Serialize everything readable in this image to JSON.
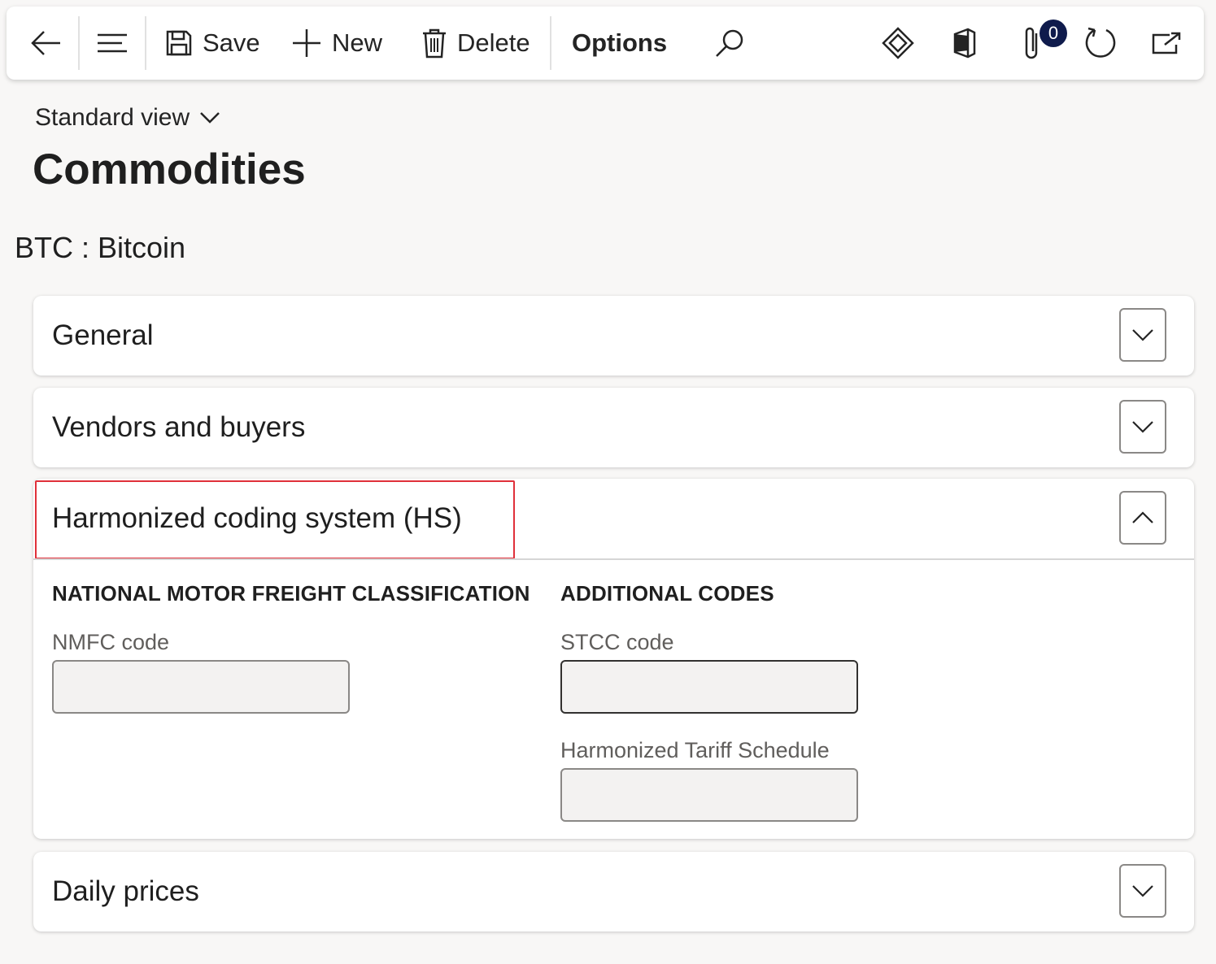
{
  "toolbar": {
    "save_label": "Save",
    "new_label": "New",
    "delete_label": "Delete",
    "options_label": "Options",
    "attachments_count": "0",
    "icons": [
      "back-arrow-icon",
      "hamburger-menu-icon",
      "save-icon",
      "plus-icon",
      "delete-icon",
      "search-icon",
      "power-apps-icon",
      "office-icon",
      "attachment-icon",
      "refresh-icon",
      "open-in-new-window-icon"
    ]
  },
  "header": {
    "view_label": "Standard view",
    "page_title": "Commodities",
    "record_title": "BTC : Bitcoin"
  },
  "fasttabs": [
    {
      "title": "General",
      "expanded": false
    },
    {
      "title": "Vendors and buyers",
      "expanded": false
    },
    {
      "title": "Harmonized coding system (HS)",
      "expanded": true
    },
    {
      "title": "Daily prices",
      "expanded": false
    }
  ],
  "hs_section": {
    "nmfc_group_title": "NATIONAL MOTOR FREIGHT CLASSIFICATION",
    "nmfc_label": "NMFC code",
    "nmfc_value": "",
    "additional_group_title": "ADDITIONAL CODES",
    "stcc_label": "STCC code",
    "stcc_value": "",
    "hts_label": "Harmonized Tariff Schedule",
    "hts_value": ""
  },
  "colors": {
    "highlight": "#e0303a",
    "badge": "#0f1b4c"
  }
}
